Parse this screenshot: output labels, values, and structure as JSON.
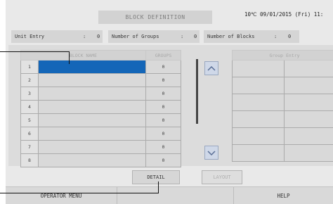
{
  "header": {
    "title": "BLOCK DEFINITION",
    "clock": "10℃ 09/01/2015 (Fri) 11:"
  },
  "counts": [
    {
      "label": "Unit Entry",
      "sep": ":",
      "value": "0"
    },
    {
      "label": "Number of Groups",
      "sep": ":",
      "value": "0"
    },
    {
      "label": "Number of Blocks",
      "sep": ":",
      "value": "0"
    }
  ],
  "block_table": {
    "headers": [
      "BLOCK NAME",
      "GROUPS"
    ],
    "rows": [
      {
        "num": "1",
        "name": "",
        "groups": "0",
        "selected": true
      },
      {
        "num": "2",
        "name": "",
        "groups": "0"
      },
      {
        "num": "3",
        "name": "",
        "groups": "0"
      },
      {
        "num": "4",
        "name": "",
        "groups": "0"
      },
      {
        "num": "5",
        "name": "",
        "groups": "0"
      },
      {
        "num": "6",
        "name": "",
        "groups": "0"
      },
      {
        "num": "7",
        "name": "",
        "groups": "0"
      },
      {
        "num": "8",
        "name": "",
        "groups": "0"
      }
    ]
  },
  "group_entry": {
    "header": "Group Entry"
  },
  "buttons": {
    "detail": "DETAIL",
    "layout": "LAYOUT"
  },
  "footer": {
    "operator_menu": "OPERATOR MENU",
    "help": "HELP"
  },
  "colors": {
    "selected_row": "#1466b8",
    "arrow_button": "#cfd8e8"
  }
}
